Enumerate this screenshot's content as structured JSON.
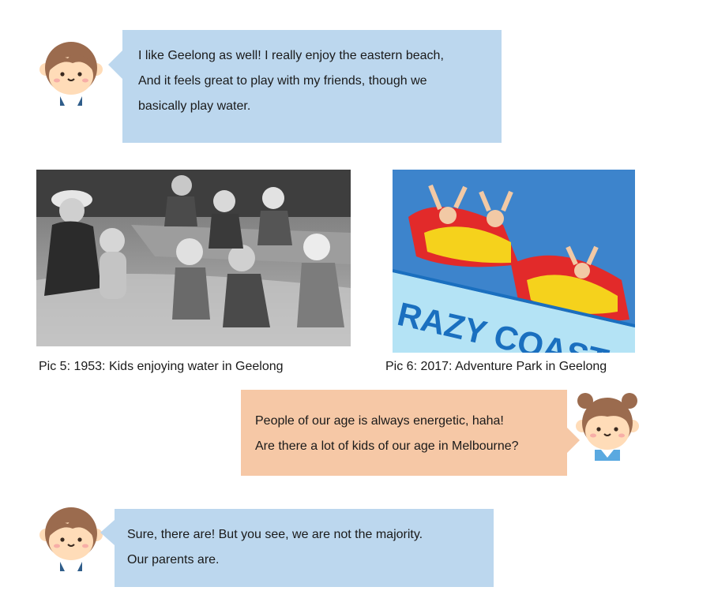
{
  "dialogue": [
    {
      "speaker": "boy",
      "lines": [
        "I like Geelong as well! I really enjoy the eastern beach,",
        "And it feels great to play with my friends, though we",
        "basically play water."
      ]
    },
    {
      "speaker": "girl",
      "lines": [
        "People of our age is always energetic, haha!",
        "Are there a lot of kids of our age in Melbourne?"
      ]
    },
    {
      "speaker": "boy",
      "lines": [
        "Sure, there are! But you see, we are not the majority.",
        "Our parents are."
      ]
    }
  ],
  "pictures": [
    {
      "caption": "Pic 5: 1953: Kids enjoying water in Geelong",
      "style": "black-and-white"
    },
    {
      "caption": "Pic 6: 2017: Adventure Park in Geelong",
      "style": "color",
      "sign_text": "RAZY COAST"
    }
  ],
  "colors": {
    "boy_bubble": "#bcd7ee",
    "girl_bubble": "#f6c8a6",
    "skin": "#ffdcb8",
    "hair": "#9b6b4e",
    "sky": "#3d84cc"
  }
}
